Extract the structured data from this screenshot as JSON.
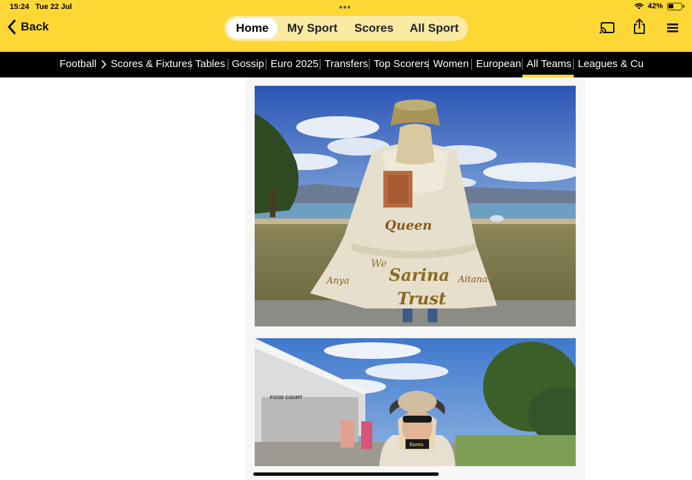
{
  "status_bar": {
    "time": "15:24",
    "date": "Tue 22 Jul",
    "battery_text": "42%",
    "battery_level": 0.42
  },
  "header": {
    "back_label": "Back",
    "tabs": [
      {
        "label": "Home",
        "active": true
      },
      {
        "label": "My Sport",
        "active": false
      },
      {
        "label": "Scores",
        "active": false
      },
      {
        "label": "All Sport",
        "active": false
      }
    ],
    "icons": [
      "cast-icon",
      "share-icon",
      "menu-icon"
    ],
    "bg_color": "#fdd835"
  },
  "subnav": {
    "items": [
      {
        "label": "Football"
      },
      {
        "label": "Scores & Fixtures"
      },
      {
        "label": "Tables"
      },
      {
        "label": "Gossip"
      },
      {
        "label": "Euro 2025"
      },
      {
        "label": "Transfers"
      },
      {
        "label": "Top Scorers"
      },
      {
        "label": "Women"
      },
      {
        "label": "European"
      },
      {
        "label": "All Teams",
        "active": true
      },
      {
        "label": "Leagues & Cu"
      }
    ],
    "bg_color": "#000000",
    "accent_color": "#fdd835"
  },
  "content": {
    "photo1": {
      "coat_text_top": "Queen",
      "coat_text_middle": "Sarina",
      "coat_text_bottom": "Trust",
      "coat_text_we": "We",
      "coat_text_left": "Anya",
      "coat_text_right": "Aitana"
    },
    "photo2": {
      "sign_text": "FOOD COURT",
      "shirt_text": "Euros"
    }
  }
}
